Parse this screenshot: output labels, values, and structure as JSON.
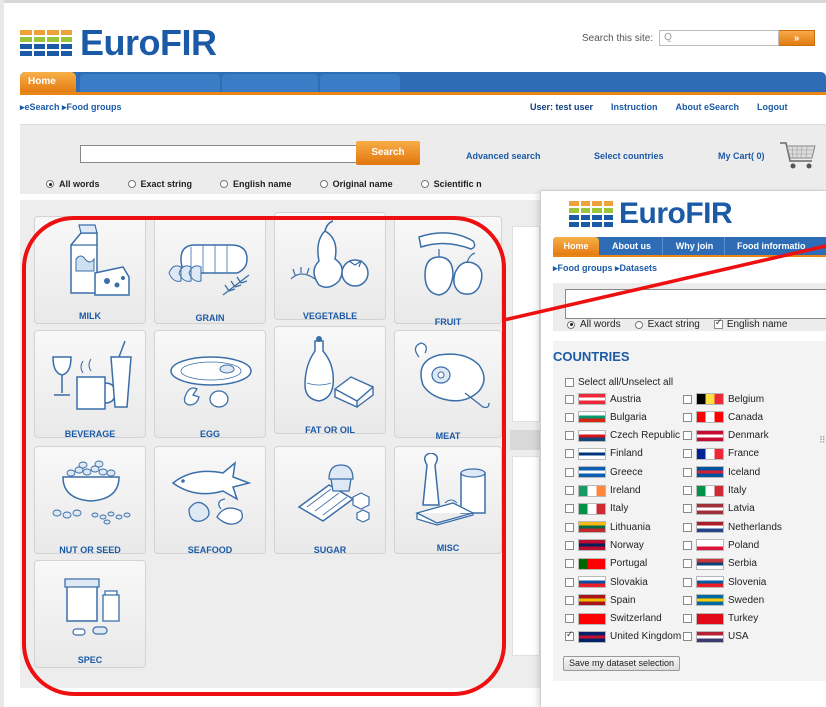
{
  "brand": {
    "name": "EuroFIR"
  },
  "site_search": {
    "label": "Search this site:",
    "placeholder": "Q",
    "button": "»"
  },
  "nav": {
    "home": "Home"
  },
  "breadcrumb": "▸eSearch ▸Food groups",
  "userbar": {
    "user": "User: test user",
    "instruction": "Instruction",
    "about": "About eSearch",
    "logout": "Logout"
  },
  "search_panel": {
    "button": "Search",
    "advanced": "Advanced search",
    "select_countries": "Select countries",
    "cart": "My Cart( 0)",
    "options": [
      "All words",
      "Exact string",
      "English name",
      "Original name",
      "Scientific n"
    ]
  },
  "food_groups": [
    {
      "label": "MILK",
      "icon": "milk-icon"
    },
    {
      "label": "GRAIN",
      "icon": "grain-icon"
    },
    {
      "label": "VEGETABLE",
      "icon": "vegetable-icon"
    },
    {
      "label": "FRUIT",
      "icon": "fruit-icon"
    },
    {
      "label": "BEVERAGE",
      "icon": "beverage-icon"
    },
    {
      "label": "EGG",
      "icon": "egg-icon"
    },
    {
      "label": "FAT OR OIL",
      "icon": "fat-oil-icon"
    },
    {
      "label": "MEAT",
      "icon": "meat-icon"
    },
    {
      "label": "NUT OR SEED",
      "icon": "nut-seed-icon"
    },
    {
      "label": "SEAFOOD",
      "icon": "seafood-icon"
    },
    {
      "label": "SUGAR",
      "icon": "sugar-icon"
    },
    {
      "label": "MISC",
      "icon": "misc-icon"
    },
    {
      "label": "SPEC",
      "icon": "spec-icon"
    }
  ],
  "popup": {
    "tabs": [
      "Home",
      "About us",
      "Why join",
      "Food informatio"
    ],
    "breadcrumb": "▸Food groups ▸Datasets",
    "options": [
      "All words",
      "Exact string",
      "English name"
    ],
    "countries_title": "COUNTRIES",
    "select_all": "Select all/Unselect all",
    "countries": [
      {
        "name": "Austria",
        "checked": false,
        "colors": [
          "#ed2939",
          "#ffffff",
          "#ed2939"
        ]
      },
      {
        "name": "Belgium",
        "checked": false,
        "colors": [
          "#000000",
          "#fae042",
          "#ed2939"
        ],
        "vertical": true
      },
      {
        "name": "Bulgaria",
        "checked": false,
        "colors": [
          "#ffffff",
          "#00966e",
          "#d62612"
        ]
      },
      {
        "name": "Canada",
        "checked": false,
        "colors": [
          "#ff0000",
          "#ffffff",
          "#ff0000"
        ],
        "vertical": true
      },
      {
        "name": "Czech Republic",
        "checked": false,
        "colors": [
          "#ffffff",
          "#d7141a",
          "#11457e"
        ]
      },
      {
        "name": "Denmark",
        "checked": false,
        "colors": [
          "#c60c30",
          "#ffffff",
          "#c60c30"
        ]
      },
      {
        "name": "Finland",
        "checked": false,
        "colors": [
          "#ffffff",
          "#003580",
          "#ffffff"
        ]
      },
      {
        "name": "France",
        "checked": false,
        "colors": [
          "#002395",
          "#ffffff",
          "#ed2939"
        ],
        "vertical": true
      },
      {
        "name": "Greece",
        "checked": false,
        "colors": [
          "#0d5eaf",
          "#ffffff",
          "#0d5eaf"
        ]
      },
      {
        "name": "Iceland",
        "checked": false,
        "colors": [
          "#02529c",
          "#dc1e35",
          "#02529c"
        ]
      },
      {
        "name": "Ireland",
        "checked": false,
        "colors": [
          "#169b62",
          "#ffffff",
          "#ff883e"
        ],
        "vertical": true
      },
      {
        "name": "Italy",
        "checked": false,
        "colors": [
          "#009246",
          "#ffffff",
          "#ce2b37"
        ],
        "vertical": true
      },
      {
        "name": "Italy",
        "checked": false,
        "colors": [
          "#009246",
          "#ffffff",
          "#ce2b37"
        ],
        "vertical": true
      },
      {
        "name": "Latvia",
        "checked": false,
        "colors": [
          "#9e3039",
          "#ffffff",
          "#9e3039"
        ]
      },
      {
        "name": "Lithuania",
        "checked": false,
        "colors": [
          "#fdb913",
          "#006a44",
          "#c1272d"
        ]
      },
      {
        "name": "Netherlands",
        "checked": false,
        "colors": [
          "#ae1c28",
          "#ffffff",
          "#21468b"
        ]
      },
      {
        "name": "Norway",
        "checked": false,
        "colors": [
          "#ba0c2f",
          "#00205b",
          "#ba0c2f"
        ]
      },
      {
        "name": "Poland",
        "checked": false,
        "colors": [
          "#ffffff",
          "#ffffff",
          "#dc143c"
        ]
      },
      {
        "name": "Portugal",
        "checked": false,
        "colors": [
          "#006600",
          "#ff0000",
          "#ff0000"
        ],
        "vertical": true
      },
      {
        "name": "Serbia",
        "checked": false,
        "colors": [
          "#c6363c",
          "#0c4076",
          "#ffffff"
        ]
      },
      {
        "name": "Slovakia",
        "checked": false,
        "colors": [
          "#ffffff",
          "#0b4ea2",
          "#ee1c25"
        ]
      },
      {
        "name": "Slovenia",
        "checked": false,
        "colors": [
          "#ffffff",
          "#005da4",
          "#ed1c24"
        ]
      },
      {
        "name": "Spain",
        "checked": false,
        "colors": [
          "#aa151b",
          "#f1bf00",
          "#aa151b"
        ]
      },
      {
        "name": "Sweden",
        "checked": false,
        "colors": [
          "#006aa7",
          "#fecc00",
          "#006aa7"
        ]
      },
      {
        "name": "Switzerland",
        "checked": false,
        "colors": [
          "#ff0000",
          "#ff0000",
          "#ff0000"
        ]
      },
      {
        "name": "Turkey",
        "checked": false,
        "colors": [
          "#e30a17",
          "#e30a17",
          "#e30a17"
        ]
      },
      {
        "name": "United Kingdom",
        "checked": true,
        "colors": [
          "#012169",
          "#c8102e",
          "#012169"
        ]
      },
      {
        "name": "USA",
        "checked": false,
        "colors": [
          "#b22234",
          "#ffffff",
          "#3c3b6e"
        ]
      }
    ],
    "save_button": "Save my dataset selection"
  },
  "colors": {
    "brand_blue": "#1b5aa7",
    "accent_orange": "#e98617",
    "annotation_red": "#ee1010"
  }
}
